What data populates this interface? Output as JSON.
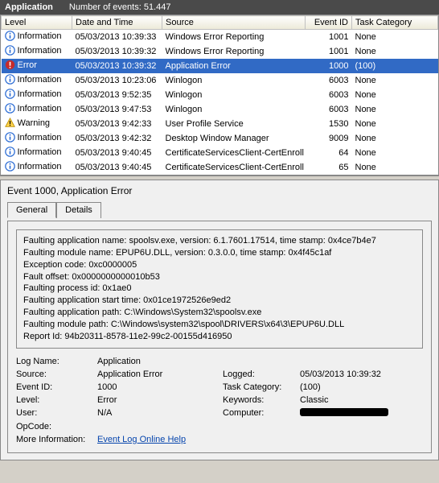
{
  "header": {
    "title": "Application",
    "count_label": "Number of events: 51.447"
  },
  "columns": {
    "level": "Level",
    "date": "Date and Time",
    "source": "Source",
    "eventid": "Event ID",
    "task": "Task Category"
  },
  "rows": [
    {
      "level": "Information",
      "icon": "info",
      "date": "05/03/2013 10:39:33",
      "source": "Windows Error Reporting",
      "eventid": "1001",
      "task": "None",
      "selected": false
    },
    {
      "level": "Information",
      "icon": "info",
      "date": "05/03/2013 10:39:32",
      "source": "Windows Error Reporting",
      "eventid": "1001",
      "task": "None",
      "selected": false
    },
    {
      "level": "Error",
      "icon": "error",
      "date": "05/03/2013 10:39:32",
      "source": "Application Error",
      "eventid": "1000",
      "task": "(100)",
      "selected": true
    },
    {
      "level": "Information",
      "icon": "info",
      "date": "05/03/2013 10:23:06",
      "source": "Winlogon",
      "eventid": "6003",
      "task": "None",
      "selected": false
    },
    {
      "level": "Information",
      "icon": "info",
      "date": "05/03/2013 9:52:35",
      "source": "Winlogon",
      "eventid": "6003",
      "task": "None",
      "selected": false
    },
    {
      "level": "Information",
      "icon": "info",
      "date": "05/03/2013 9:47:53",
      "source": "Winlogon",
      "eventid": "6003",
      "task": "None",
      "selected": false
    },
    {
      "level": "Warning",
      "icon": "warning",
      "date": "05/03/2013 9:42:33",
      "source": "User Profile Service",
      "eventid": "1530",
      "task": "None",
      "selected": false
    },
    {
      "level": "Information",
      "icon": "info",
      "date": "05/03/2013 9:42:32",
      "source": "Desktop Window Manager",
      "eventid": "9009",
      "task": "None",
      "selected": false
    },
    {
      "level": "Information",
      "icon": "info",
      "date": "05/03/2013 9:40:45",
      "source": "CertificateServicesClient-CertEnroll",
      "eventid": "64",
      "task": "None",
      "selected": false
    },
    {
      "level": "Information",
      "icon": "info",
      "date": "05/03/2013 9:40:45",
      "source": "CertificateServicesClient-CertEnroll",
      "eventid": "65",
      "task": "None",
      "selected": false
    }
  ],
  "detail": {
    "title": "Event 1000, Application Error",
    "tabs": {
      "general": "General",
      "details": "Details"
    },
    "msg_lines": [
      "Faulting application name: spoolsv.exe, version: 6.1.7601.17514, time stamp: 0x4ce7b4e7",
      "Faulting module name: EPUP6U.DLL, version: 0.3.0.0, time stamp: 0x4f45c1af",
      "Exception code: 0xc0000005",
      "Fault offset: 0x0000000000010b53",
      "Faulting process id: 0x1ae0",
      "Faulting application start time: 0x01ce1972526e9ed2",
      "Faulting application path: C:\\Windows\\System32\\spoolsv.exe",
      "Faulting module path: C:\\Windows\\system32\\spool\\DRIVERS\\x64\\3\\EPUP6U.DLL",
      "Report Id: 94b20311-8578-11e2-99c2-00155d416950"
    ],
    "kv": {
      "logname_k": "Log Name:",
      "logname_v": "Application",
      "source_k": "Source:",
      "source_v": "Application Error",
      "logged_k": "Logged:",
      "logged_v": "05/03/2013 10:39:32",
      "eventid_k": "Event ID:",
      "eventid_v": "1000",
      "taskcat_k": "Task Category:",
      "taskcat_v": "(100)",
      "level_k": "Level:",
      "level_v": "Error",
      "keywords_k": "Keywords:",
      "keywords_v": "Classic",
      "user_k": "User:",
      "user_v": "N/A",
      "computer_k": "Computer:",
      "opcode_k": "OpCode:",
      "moreinfo_k": "More Information:",
      "moreinfo_link": "Event Log Online Help"
    }
  }
}
